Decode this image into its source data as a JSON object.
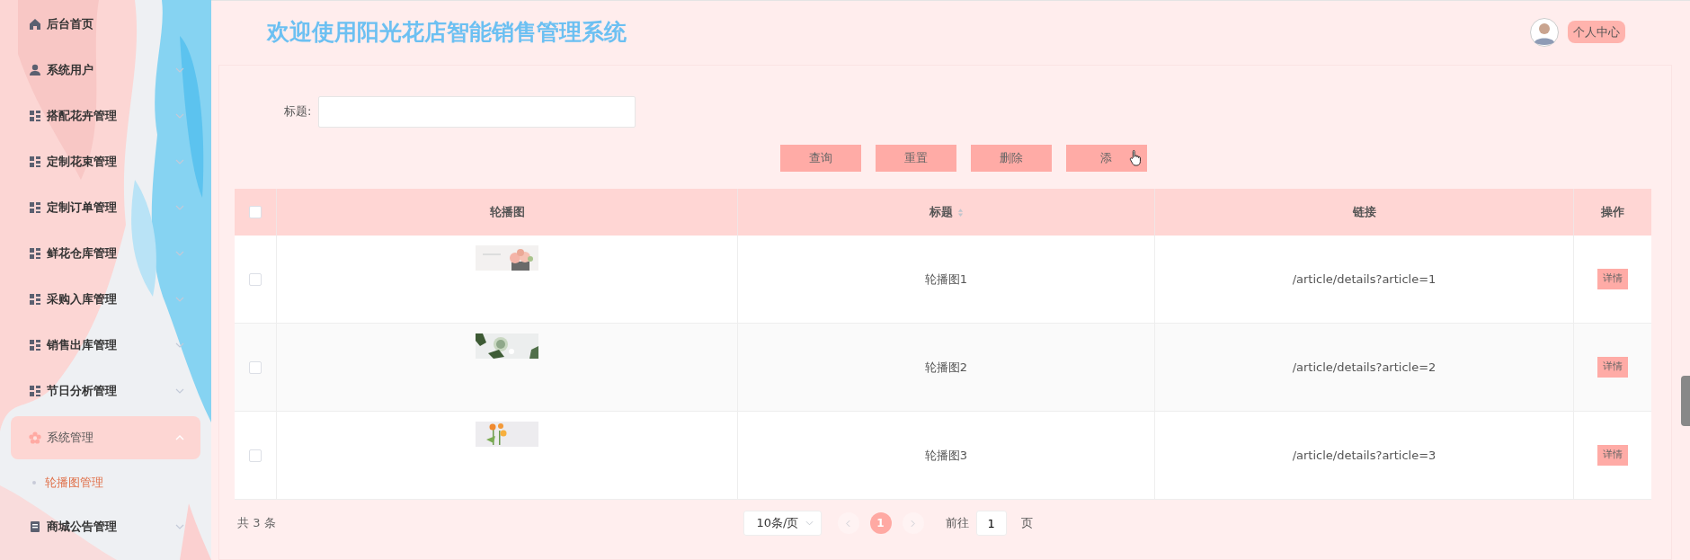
{
  "sidebar": {
    "items": [
      {
        "label": "后台首页",
        "selected": false
      },
      {
        "label": "系统用户",
        "expanded": false,
        "selected": false
      },
      {
        "label": "搭配花卉管理",
        "expanded": false,
        "selected": false
      },
      {
        "label": "定制花束管理",
        "expanded": false,
        "selected": false
      },
      {
        "label": "定制订单管理",
        "expanded": false,
        "selected": false
      },
      {
        "label": "鲜花仓库管理",
        "expanded": false,
        "selected": false
      },
      {
        "label": "采购入库管理",
        "expanded": false,
        "selected": false
      },
      {
        "label": "销售出库管理",
        "expanded": false,
        "selected": false
      },
      {
        "label": "节日分析管理",
        "expanded": false,
        "selected": false
      },
      {
        "label": "系统管理",
        "expanded": true,
        "selected": true,
        "children": [
          {
            "label": "轮播图管理",
            "selected": true
          }
        ]
      },
      {
        "label": "商城公告管理",
        "expanded": false,
        "selected": false
      }
    ]
  },
  "header": {
    "title": "欢迎使用阳光花店智能销售管理系统",
    "profile_button": "个人中心"
  },
  "search": {
    "label": "标题:"
  },
  "buttons": [
    "查询",
    "重置",
    "删除",
    "添"
  ],
  "table": {
    "select_all_checked": false,
    "columns": [
      "轮播图",
      "标题",
      "链接",
      "操作"
    ],
    "rows": [
      {
        "checked": false,
        "title": "轮播图1",
        "link": "/article/details?article=1",
        "action": "详情"
      },
      {
        "checked": false,
        "title": "轮播图2",
        "link": "/article/details?article=2",
        "action": "详情"
      },
      {
        "checked": false,
        "title": "轮播图3",
        "link": "/article/details?article=3",
        "action": "详情"
      }
    ]
  },
  "pagination": {
    "total": "共 3 条",
    "page_size": "10条/页",
    "pages": [
      {
        "label": "1",
        "selected": true
      }
    ],
    "goto_label": "前往",
    "goto_value": "1",
    "goto_suffix": "页"
  }
}
